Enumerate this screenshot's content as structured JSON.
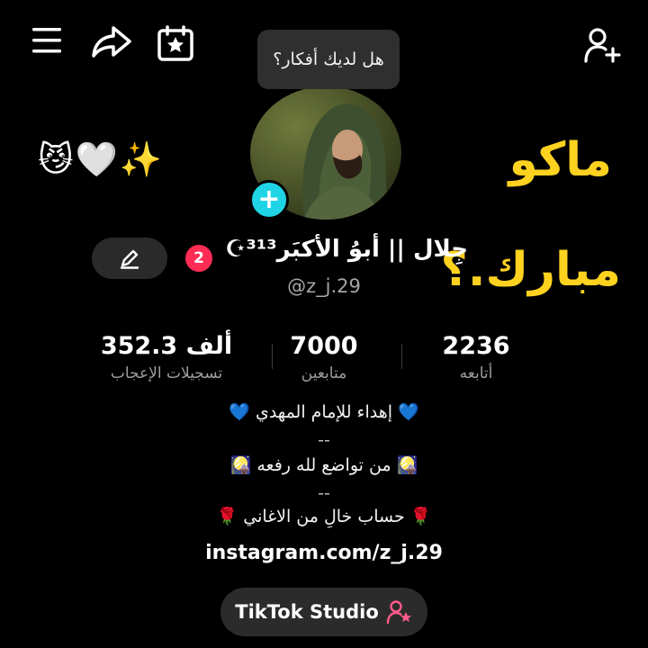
{
  "header": {
    "thoughts_prompt": "هل لديك أفكار؟"
  },
  "decor": {
    "emoji_row": "😼🤍✨",
    "text_maku": "ماكو",
    "text_mubarak": "مبارك.؟"
  },
  "profile": {
    "notification_count": "2",
    "display_name": "جِلال || أبوُ الأكبَر³¹³☪",
    "username": "@z_j.29"
  },
  "stats": [
    {
      "value": "352.3 ألف",
      "label": "تسجيلات الإعجاب"
    },
    {
      "value": "7000",
      "label": "متابعين"
    },
    {
      "value": "2236",
      "label": "أتابعه"
    }
  ],
  "bio": {
    "line1": "💙 إهداء للإمام المهدي 💙",
    "line2": "--",
    "line3": "🎑 من تواضع لله رفعه 🎑",
    "line4": "--",
    "line5": "🌹 حساب خالِ من الاغاني 🌹",
    "link": "instagram.com/z_j.29"
  },
  "studio": {
    "label": "TikTok Studio"
  },
  "colors": {
    "accent_cyan": "#1fd5e5",
    "badge_red": "#fe2c55",
    "deco_yellow": "#ffd21f"
  },
  "icons": [
    "menu-icon",
    "share-icon",
    "calendar-star-icon",
    "add-user-icon",
    "pencil-icon",
    "plus-icon",
    "person-star-icon"
  ]
}
